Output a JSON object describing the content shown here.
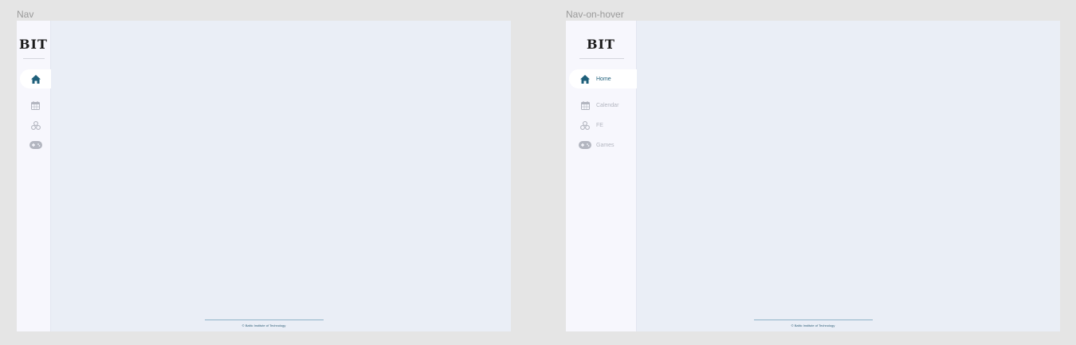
{
  "frames": {
    "nav": {
      "label": "Nav"
    },
    "hover": {
      "label": "Nav-on-hover"
    }
  },
  "logo": "BIT",
  "nav_items": [
    {
      "label": "Home",
      "icon": "home-icon",
      "active": true
    },
    {
      "label": "Calendar",
      "icon": "calendar-icon",
      "active": false
    },
    {
      "label": "FE",
      "icon": "cubes-icon",
      "active": false
    },
    {
      "label": "Games",
      "icon": "gamepad-icon",
      "active": false
    }
  ],
  "footer": "© Baltic Institute of Technology",
  "colors": {
    "accent": "#1e5f7a",
    "inactive": "#b3b6c0",
    "content_bg": "#eaeef6",
    "sidebar_bg": "#f7f7fd"
  }
}
